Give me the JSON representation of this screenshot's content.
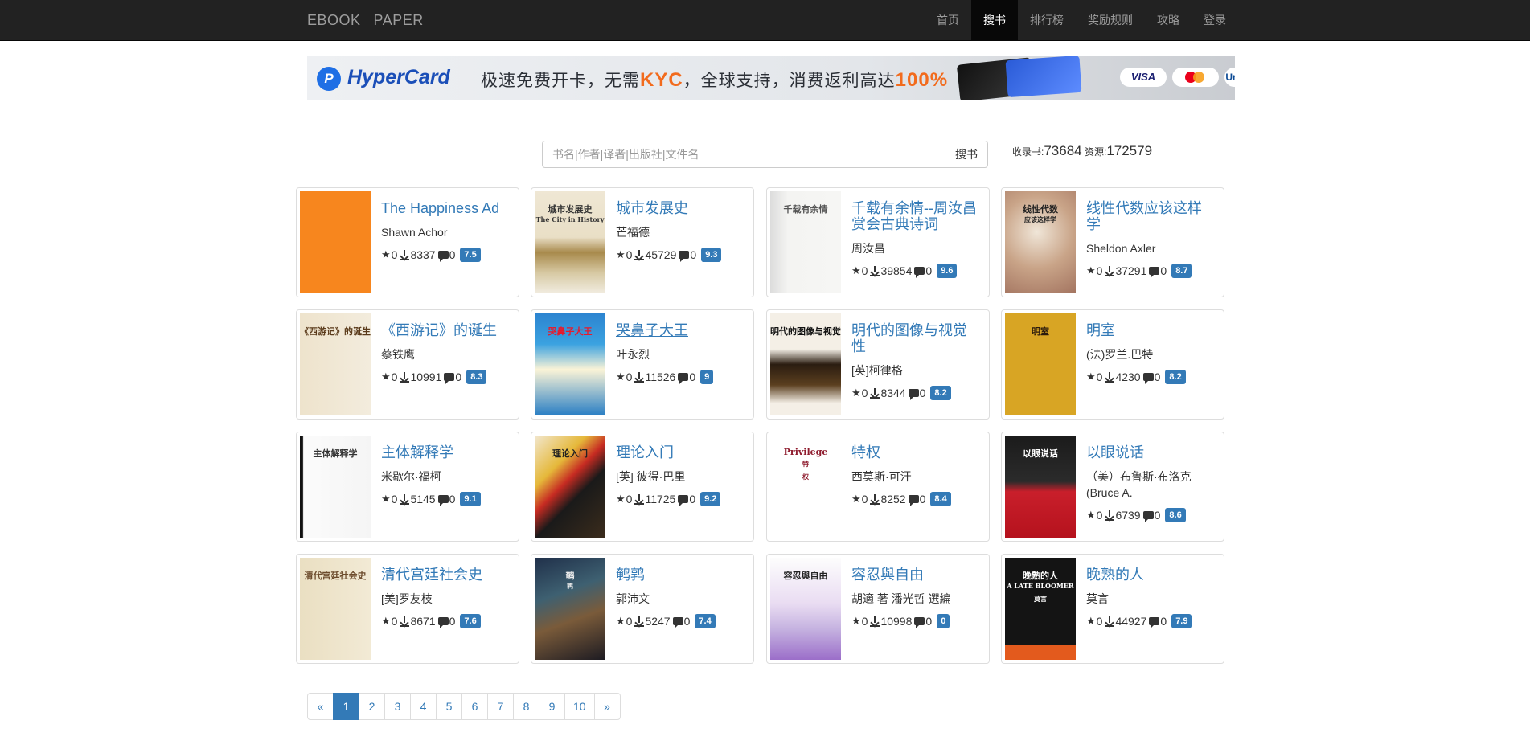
{
  "navbar": {
    "brand_left": "EBOOK",
    "brand_right": "PAPER",
    "items": [
      {
        "label": "首页"
      },
      {
        "label": "搜书"
      },
      {
        "label": "排行榜"
      },
      {
        "label": "奖励规则"
      },
      {
        "label": "攻略"
      },
      {
        "label": "登录"
      }
    ],
    "active": "搜书"
  },
  "banner": {
    "logo": "P",
    "brand": "HyperCard",
    "slogan_a": "极速免费开卡，无需",
    "slogan_kyc": "KYC",
    "slogan_b": "，全球支持，消费返利高达",
    "slogan_pct": "100%",
    "pay_visa": "VISA",
    "pay_jcb": "UnionPay"
  },
  "search": {
    "placeholder": "书名|作者|译者|出版社|文件名",
    "button": "搜书"
  },
  "stats": {
    "books_label": "收录书:",
    "books_value": "73684",
    "res_label": "资源:",
    "res_value": "172579"
  },
  "books": [
    {
      "title": "The Happiness Ad",
      "author": "Shawn Achor",
      "stars": "0",
      "downloads": "8337",
      "comments": "0",
      "score": "7.5"
    },
    {
      "title": "城市发展史",
      "author": "芒福德",
      "stars": "0",
      "downloads": "45729",
      "comments": "0",
      "score": "9.3"
    },
    {
      "title": "千载有余情--周汝昌赏会古典诗词",
      "author": "周汝昌",
      "stars": "0",
      "downloads": "39854",
      "comments": "0",
      "score": "9.6"
    },
    {
      "title": "线性代数应该这样学",
      "author": "Sheldon Axler",
      "stars": "0",
      "downloads": "37291",
      "comments": "0",
      "score": "8.7"
    },
    {
      "title": "《西游记》的诞生",
      "author": "蔡铁鹰",
      "stars": "0",
      "downloads": "10991",
      "comments": "0",
      "score": "8.3"
    },
    {
      "title": "哭鼻子大王",
      "author": "叶永烈",
      "stars": "0",
      "downloads": "11526",
      "comments": "0",
      "score": "9"
    },
    {
      "title": "明代的图像与视觉性",
      "author": "[英]柯律格",
      "stars": "0",
      "downloads": "8344",
      "comments": "0",
      "score": "8.2"
    },
    {
      "title": "明室",
      "author": "(法)罗兰.巴特",
      "stars": "0",
      "downloads": "4230",
      "comments": "0",
      "score": "8.2"
    },
    {
      "title": "主体解释学",
      "author": "米歇尔·福柯",
      "stars": "0",
      "downloads": "5145",
      "comments": "0",
      "score": "9.1"
    },
    {
      "title": "理论入门",
      "author": "[英] 彼得·巴里",
      "stars": "0",
      "downloads": "11725",
      "comments": "0",
      "score": "9.2"
    },
    {
      "title": "特权",
      "author": "西莫斯·可汗",
      "stars": "0",
      "downloads": "8252",
      "comments": "0",
      "score": "8.4"
    },
    {
      "title": "以眼说话",
      "author": "（美）布鲁斯·布洛克 (Bruce A.",
      "stars": "0",
      "downloads": "6739",
      "comments": "0",
      "score": "8.6"
    },
    {
      "title": "清代宫廷社会史",
      "author": "[美]罗友枝",
      "stars": "0",
      "downloads": "8671",
      "comments": "0",
      "score": "7.6"
    },
    {
      "title": "鹌鹑",
      "author": "郭沛文",
      "stars": "0",
      "downloads": "5247",
      "comments": "0",
      "score": "7.4"
    },
    {
      "title": "容忍與自由",
      "author": "胡適 著 潘光哲 選編",
      "stars": "0",
      "downloads": "10998",
      "comments": "0",
      "score": "0"
    },
    {
      "title": "晚熟的人",
      "author": "莫言",
      "stars": "0",
      "downloads": "44927",
      "comments": "0",
      "score": "7.9"
    }
  ],
  "covers": [
    {
      "lines": [
        "",
        "",
        "",
        ""
      ]
    },
    {
      "lines": [
        "城市发展史",
        "The City in History",
        "",
        ""
      ]
    },
    {
      "lines": [
        "千载有余情",
        "",
        "",
        ""
      ]
    },
    {
      "lines": [
        "线性代数",
        "应该这样学",
        "",
        ""
      ]
    },
    {
      "lines": [
        "《西游记》的诞生",
        "",
        "",
        ""
      ]
    },
    {
      "lines": [
        "哭鼻子大王",
        "",
        "",
        ""
      ]
    },
    {
      "lines": [
        "明代的图像与视觉性",
        "",
        "",
        ""
      ]
    },
    {
      "lines": [
        "明室",
        "",
        "",
        ""
      ]
    },
    {
      "lines": [
        "主体解释学",
        "",
        "",
        ""
      ]
    },
    {
      "lines": [
        "理论入门",
        "",
        "",
        ""
      ]
    },
    {
      "lines": [
        "Privilege",
        "特",
        "权",
        ""
      ]
    },
    {
      "lines": [
        "以眼说话",
        "",
        "",
        ""
      ]
    },
    {
      "lines": [
        "清代宫廷社会史",
        "",
        "",
        ""
      ]
    },
    {
      "lines": [
        "鹌",
        "鹑",
        "",
        ""
      ]
    },
    {
      "lines": [
        "容忍與自由",
        "",
        "",
        ""
      ]
    },
    {
      "lines": [
        "晚熟的人",
        "A LATE BLOOMER",
        "莫言",
        ""
      ]
    }
  ],
  "pagination": [
    "«",
    "1",
    "2",
    "3",
    "4",
    "5",
    "6",
    "7",
    "8",
    "9",
    "10",
    "»"
  ],
  "current_page": "1",
  "colors": {
    "navbar": "#222222",
    "link": "#337ab7",
    "badge": "#337ab7",
    "accent_orange": "#f26b1d"
  },
  "icons": [
    "star-icon",
    "download-icon",
    "comment-icon"
  ]
}
